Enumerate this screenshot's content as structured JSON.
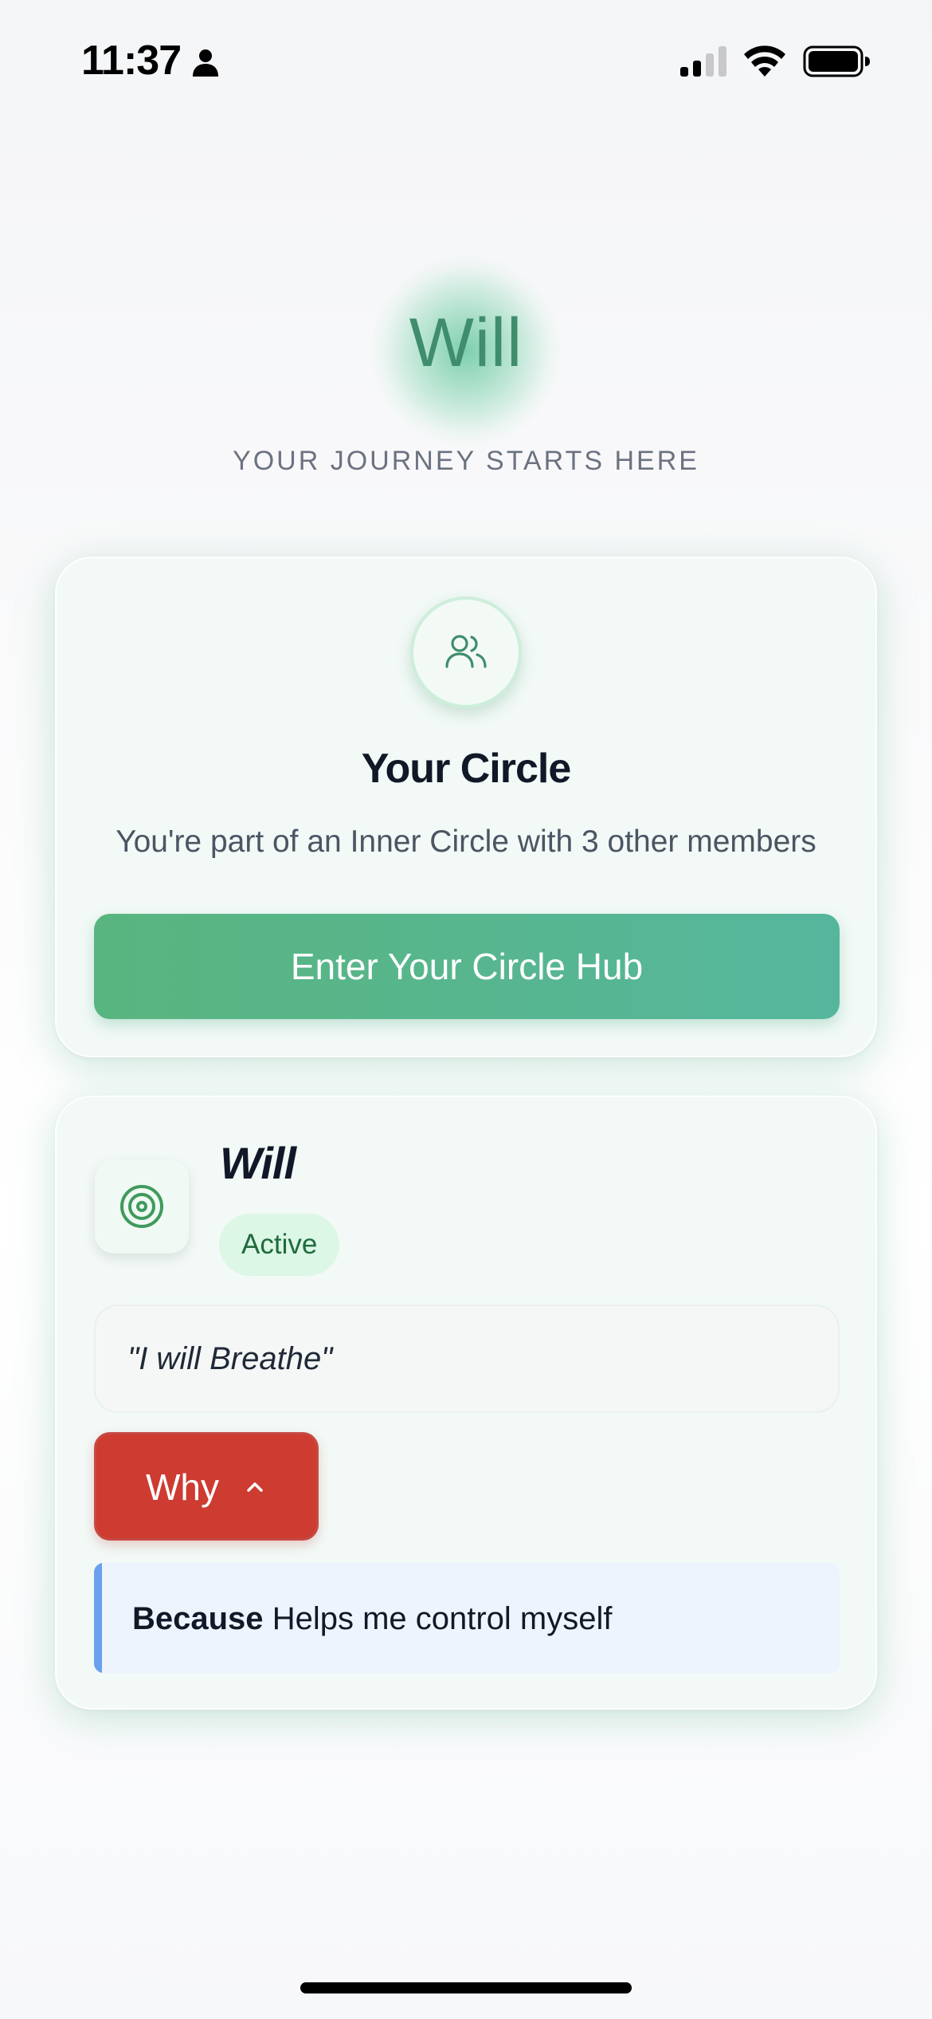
{
  "status_bar": {
    "time": "11:37",
    "icons": [
      "person-icon",
      "cellular-signal-icon",
      "wifi-icon",
      "battery-icon"
    ]
  },
  "header": {
    "title": "Will",
    "subtitle": "YOUR JOURNEY STARTS HERE"
  },
  "circle_card": {
    "icon": "users-icon",
    "title": "Your Circle",
    "description": "You're part of an Inner Circle with 3 other members",
    "button_label": "Enter Your Circle Hub"
  },
  "will_card": {
    "icon": "target-icon",
    "name": "Will",
    "status": "Active",
    "quote": "\"I will Breathe\"",
    "why_button_label": "Why",
    "why_chevron_icon": "chevron-up-icon",
    "because_label": "Because",
    "because_text": "Helps me control myself"
  },
  "colors": {
    "accent_green": "#59b57f",
    "title_green": "#3f8d6c",
    "why_red": "#cd3b31",
    "because_blue": "#6aa0ee",
    "badge_bg": "#dcf7e5"
  }
}
